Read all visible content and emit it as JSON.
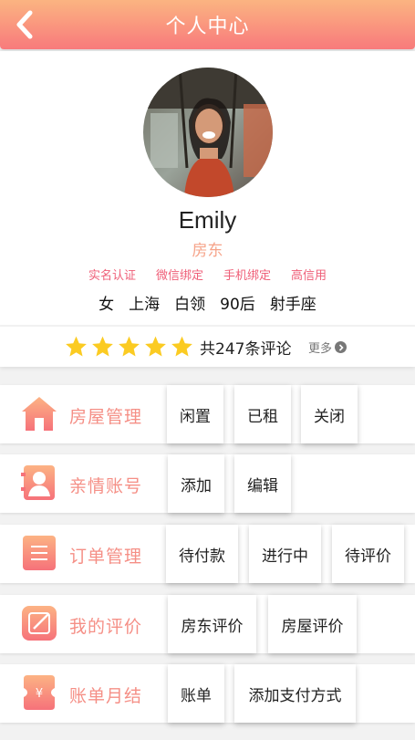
{
  "header": {
    "title": "个人中心"
  },
  "profile": {
    "name": "Emily",
    "role": "房东",
    "badges": [
      "实名认证",
      "微信绑定",
      "手机绑定",
      "高信用"
    ],
    "tags": [
      "女",
      "上海",
      "白领",
      "90后",
      "射手座"
    ]
  },
  "rating": {
    "stars": 5,
    "review_text": "共247条评论",
    "more_label": "更多"
  },
  "sections": [
    {
      "title": "房屋管理",
      "icon": "house-icon",
      "buttons": [
        "闲置",
        "已租",
        "关闭"
      ]
    },
    {
      "title": "亲情账号",
      "icon": "person-icon",
      "buttons": [
        "添加",
        "编辑"
      ]
    },
    {
      "title": "订单管理",
      "icon": "list-icon",
      "buttons": [
        "待付款",
        "进行中",
        "待评价"
      ]
    },
    {
      "title": "我的评价",
      "icon": "edit-icon",
      "buttons": [
        "房东评价",
        "房屋评价"
      ]
    },
    {
      "title": "账单月结",
      "icon": "bill-icon",
      "buttons": [
        "账单",
        "添加支付方式"
      ]
    }
  ],
  "colors": {
    "header_gradient_top": "#fbb481",
    "header_gradient_bottom": "#f87a7c",
    "badge_text": "#ef5f78",
    "section_title": "#f58f86",
    "star": "#fbcb22"
  }
}
